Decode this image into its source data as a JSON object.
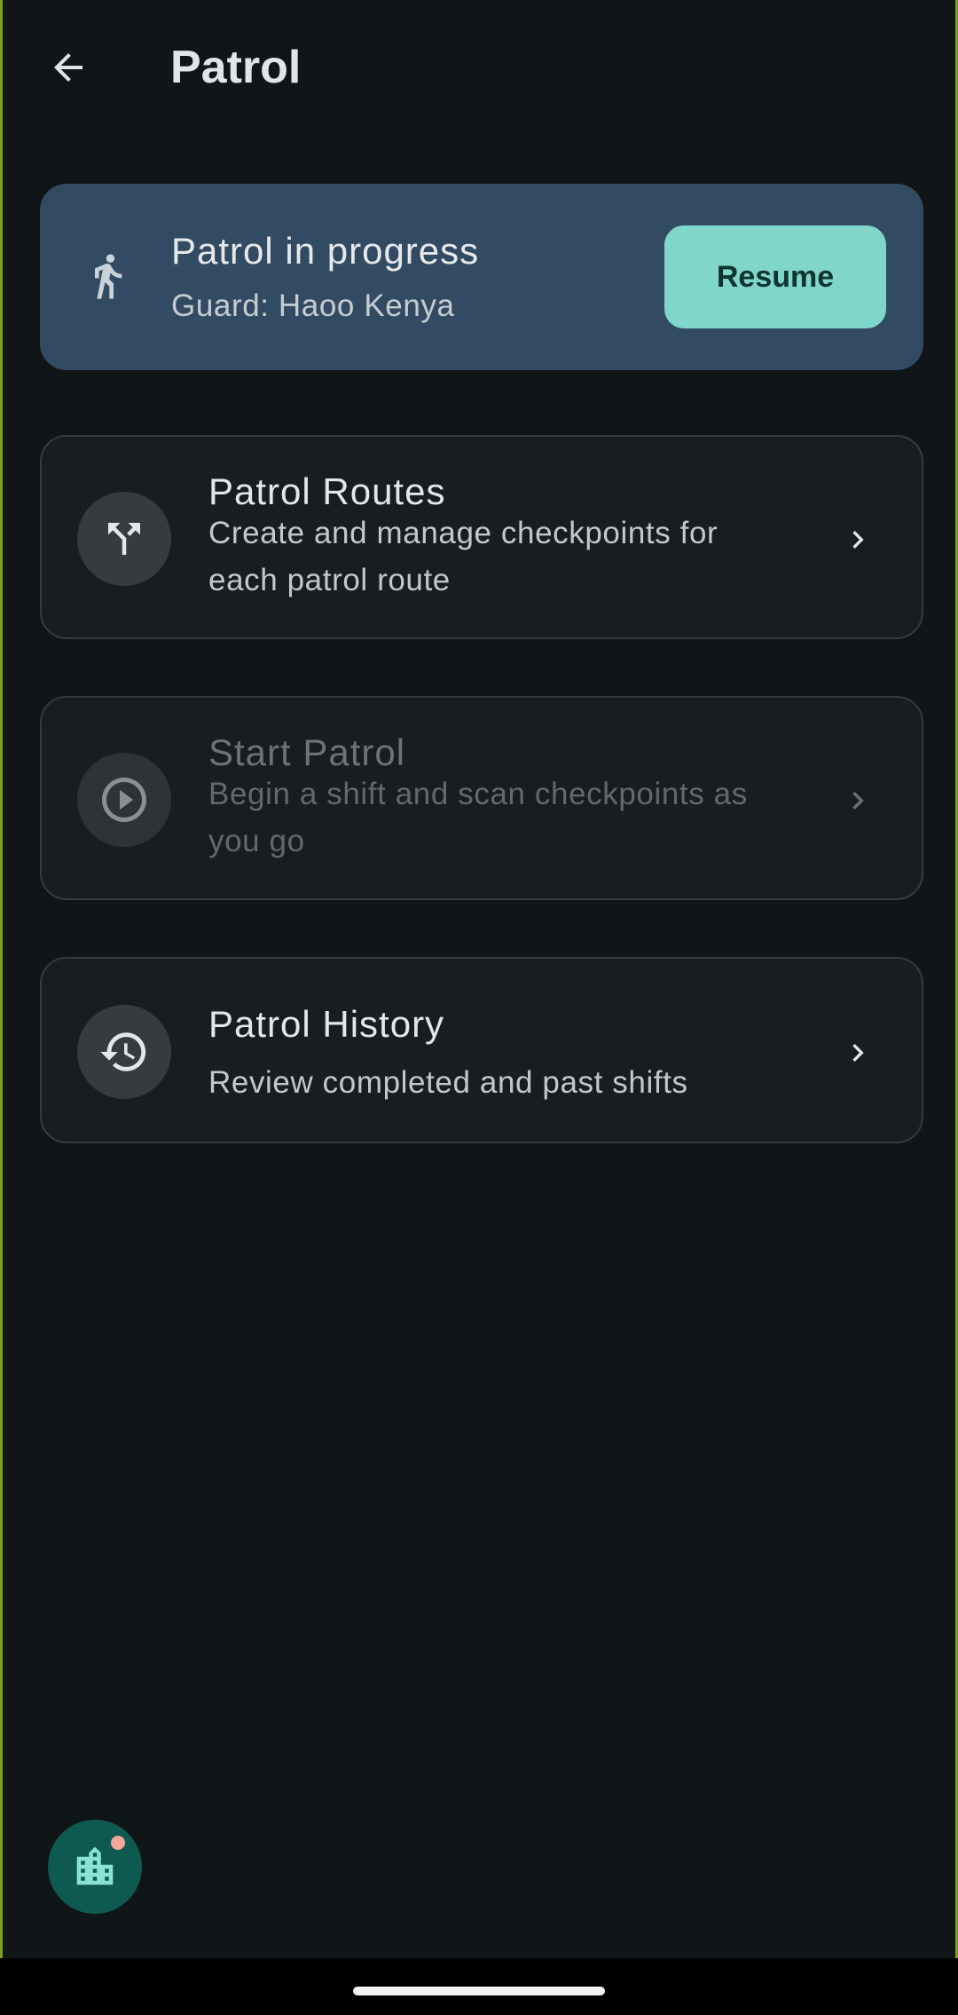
{
  "app_bar": {
    "title": "Patrol",
    "back_icon": "arrow-back-icon"
  },
  "banner": {
    "icon": "walking-person-icon",
    "title": "Patrol in progress",
    "subtitle": "Guard: Haoo Kenya",
    "action_label": "Resume"
  },
  "menu": [
    {
      "icon": "route-fork-icon",
      "title": "Patrol Routes",
      "description": "Create and manage checkpoints for each patrol route",
      "enabled": true
    },
    {
      "icon": "play-circle-icon",
      "title": "Start Patrol",
      "description": "Begin a shift and scan checkpoints as you go",
      "enabled": false
    },
    {
      "icon": "history-icon",
      "title": "Patrol History",
      "description": "Review completed and past shifts",
      "enabled": true
    }
  ],
  "fab": {
    "icon": "building-icon",
    "has_badge": true
  },
  "colors": {
    "background": "#101517",
    "banner": "#324b63",
    "accent": "#80d6ca",
    "fab": "#0f5a50",
    "badge": "#f3a69a",
    "frame": "#7aa21f"
  }
}
